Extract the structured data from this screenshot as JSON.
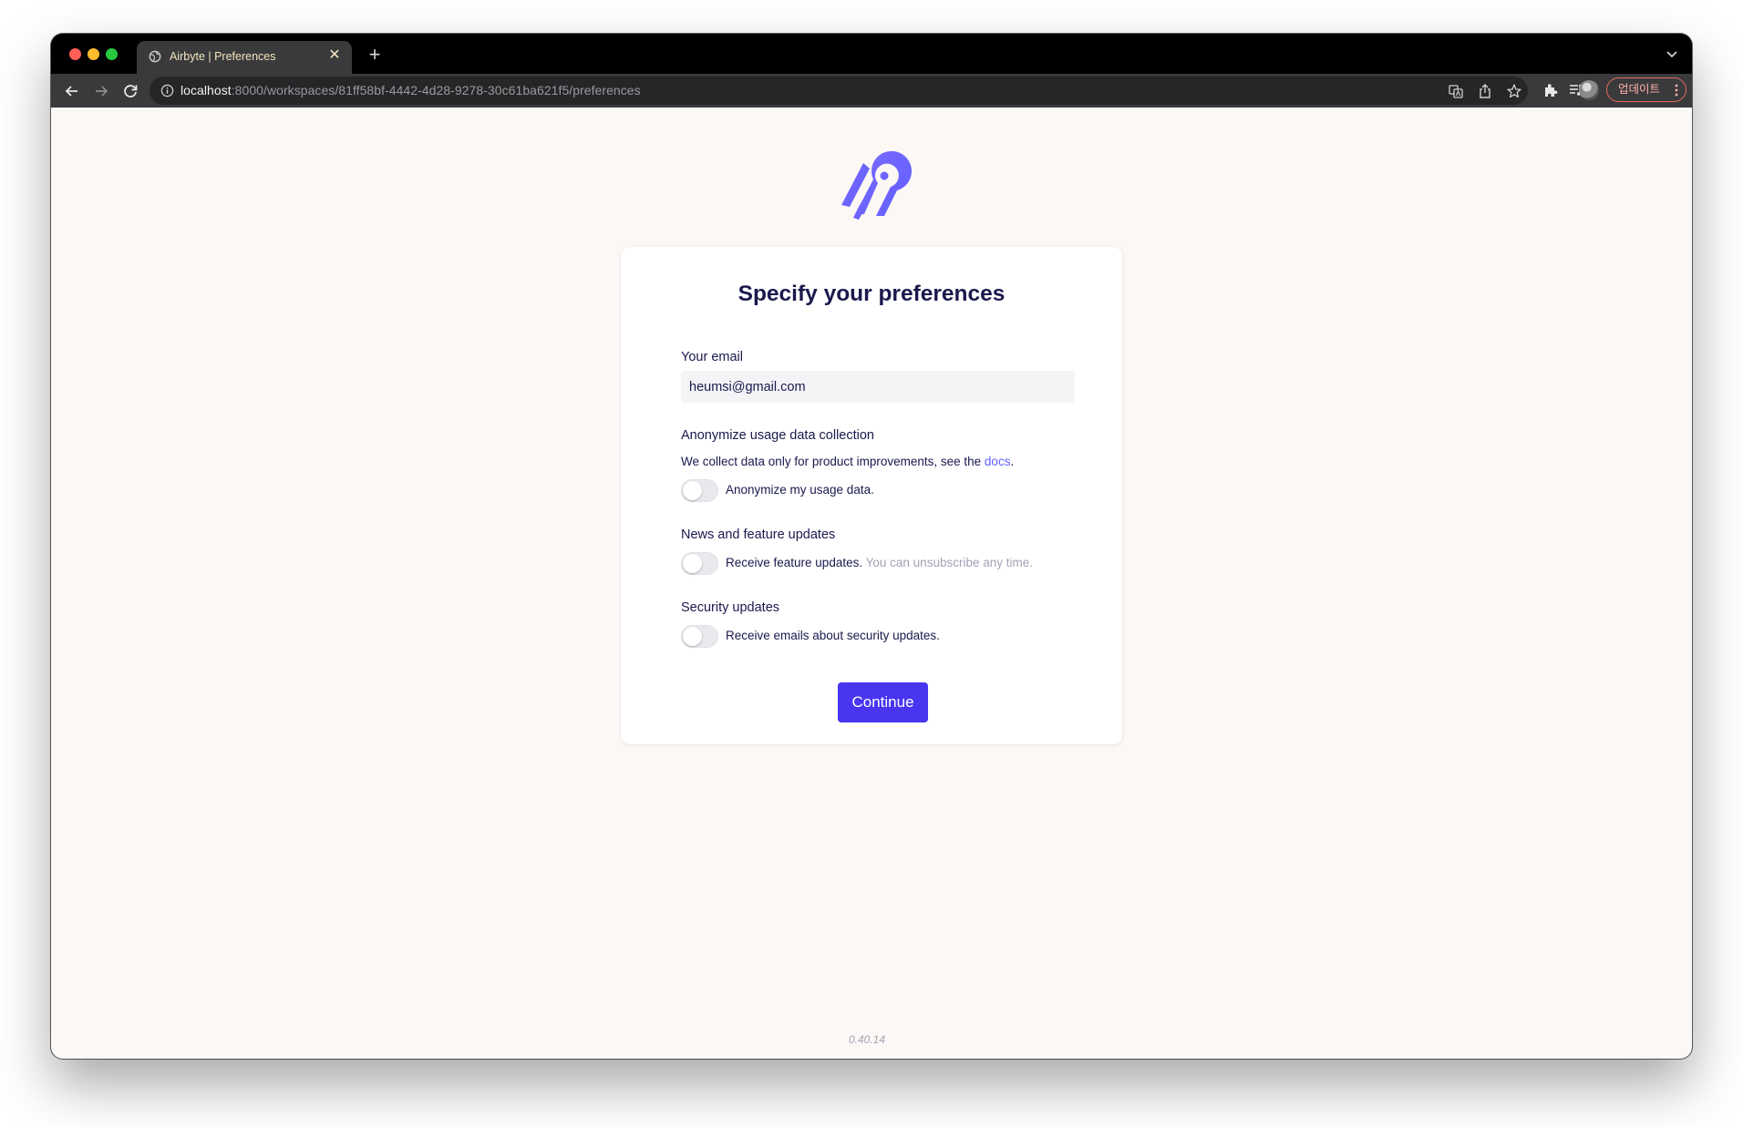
{
  "browser": {
    "tab_title": "Airbyte | Preferences",
    "tab_close": "✕",
    "new_tab": "+",
    "url_host": "localhost",
    "url_path": ":8000/workspaces/81ff58bf-4442-4d28-9278-30c61ba621f5/preferences",
    "update_label": "업데이트",
    "icons": [
      "back-icon",
      "forward-icon",
      "reload-icon",
      "info-icon",
      "translate-icon",
      "share-icon",
      "star-icon",
      "extensions-icon",
      "reading-list-icon",
      "side-panel-icon",
      "profile-avatar",
      "more-icon"
    ]
  },
  "page": {
    "title": "Specify your preferences",
    "email": {
      "label": "Your email",
      "value": "heumsi@gmail.com"
    },
    "anonymize": {
      "label": "Anonymize usage data collection",
      "description": "We collect data only for product improvements, see the ",
      "docs_link": "docs",
      "description_end": ".",
      "toggle_label": "Anonymize my usage data.",
      "checked": false
    },
    "news": {
      "label": "News and feature updates",
      "toggle_label": "Receive feature updates.",
      "toggle_hint": "You can unsubscribe any time.",
      "checked": false
    },
    "security": {
      "label": "Security updates",
      "toggle_label": "Receive emails about security updates.",
      "checked": false
    },
    "continue_label": "Continue",
    "version": "0.40.14"
  },
  "colors": {
    "brand": "#615eff",
    "button": "#4835f0",
    "text": "#1a194d",
    "page_bg": "#fcf8f5"
  }
}
